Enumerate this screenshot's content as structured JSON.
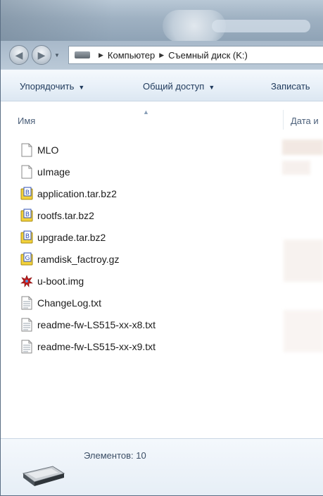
{
  "address": {
    "path": [
      "Компьютер",
      "Съемный диск (K:)"
    ]
  },
  "toolbar": {
    "organize_label": "Упорядочить",
    "share_label": "Общий доступ",
    "burn_label": "Записать"
  },
  "columns": {
    "name": "Имя",
    "date": "Дата и"
  },
  "files": [
    {
      "name": "MLO",
      "icon": "blank-file-icon"
    },
    {
      "name": "uImage",
      "icon": "blank-file-icon"
    },
    {
      "name": "application.tar.bz2",
      "icon": "archive-b-icon"
    },
    {
      "name": "rootfs.tar.bz2",
      "icon": "archive-b-icon"
    },
    {
      "name": "upgrade.tar.bz2",
      "icon": "archive-b-icon"
    },
    {
      "name": "ramdisk_factroy.gz",
      "icon": "archive-g-icon"
    },
    {
      "name": "u-boot.img",
      "icon": "disk-image-icon"
    },
    {
      "name": "ChangeLog.txt",
      "icon": "text-file-icon"
    },
    {
      "name": "readme-fw-LS515-xx-x8.txt",
      "icon": "text-file-icon"
    },
    {
      "name": "readme-fw-LS515-xx-x9.txt",
      "icon": "text-file-icon"
    }
  ],
  "details": {
    "count_text": "Элементов: 10"
  },
  "colors": {
    "command_text": "#1e395b",
    "header_text": "#4c607a",
    "archive_yellow": "#f2d13b",
    "archive_blue": "#2d4fb4"
  }
}
